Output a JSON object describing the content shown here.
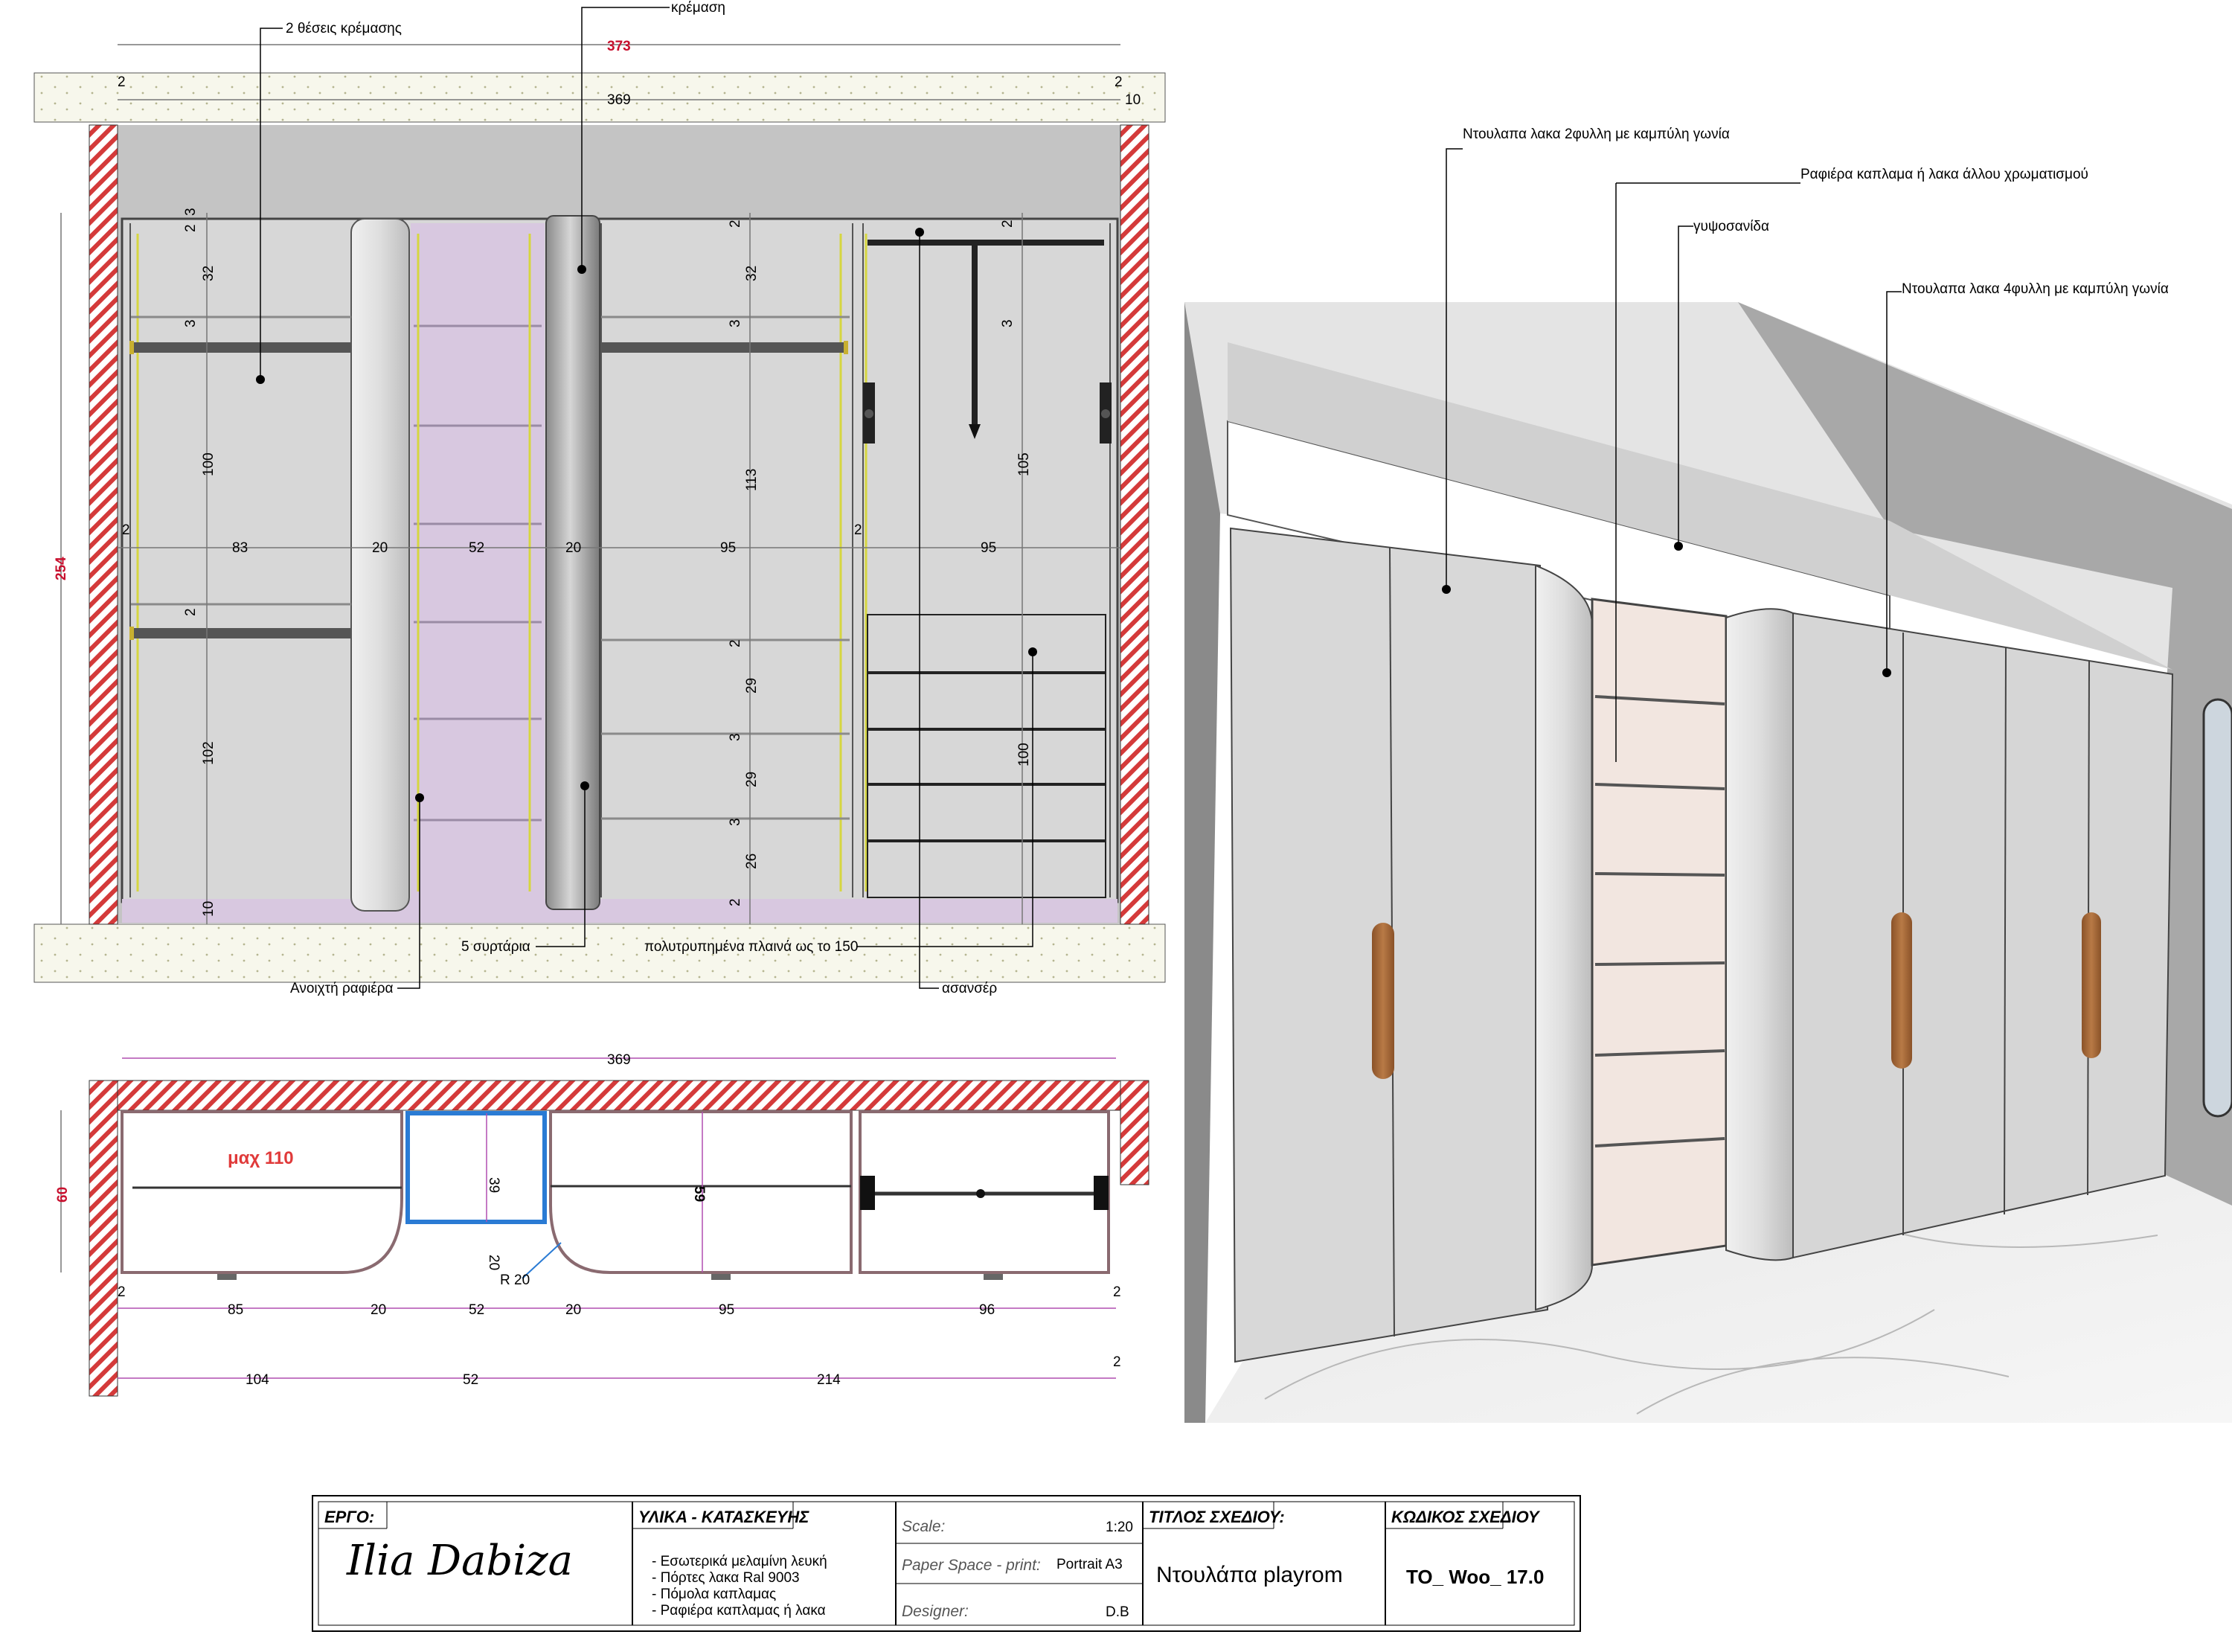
{
  "elevation": {
    "annotations": {
      "hanging_positions": "2 θέσεις κρέμασης",
      "hanging": "κρέμαση",
      "drawers": "5 συρτάρια",
      "open_shelf": "Ανοιχτή ραφιέρα",
      "perforated_sides": "πολυτρυπημένα πλαινά ως το 150",
      "lift": "ασανσέρ"
    },
    "dims": {
      "total_width": "373",
      "inner_width": "369",
      "height": "254",
      "left_edge": "2",
      "right_edge": "2",
      "right_ten": "10",
      "w83": "83",
      "w20a": "20",
      "w52": "52",
      "w20b": "20",
      "w95a": "95",
      "w95b": "95",
      "v2a": "2",
      "v3a": "3",
      "v32": "32",
      "v3b": "3",
      "v100": "100",
      "v2b": "2",
      "v102": "102",
      "v10": "10",
      "m2a": "2",
      "m32": "32",
      "m3": "3",
      "m113": "113",
      "m2b": "2",
      "m29a": "29",
      "m3b": "3",
      "m29b": "29",
      "m3c": "3",
      "m26": "26",
      "m2c": "2",
      "r2": "2",
      "r3": "3",
      "r105": "105",
      "r100": "100",
      "side2l": "2",
      "side2r": "2"
    }
  },
  "plan": {
    "dims": {
      "total": "369",
      "depth": "60",
      "max_label": "μαχ 110",
      "d39": "39",
      "d20": "20",
      "d59": "59",
      "radius": "R 20",
      "b85": "85",
      "b20a": "20",
      "b52": "52",
      "b20b": "20",
      "b95": "95",
      "b96": "96",
      "c104": "104",
      "c52": "52",
      "c214": "214",
      "edge2a": "2",
      "edge2b": "2",
      "edge2c": "2"
    }
  },
  "perspective": {
    "annotations": {
      "two_door": "Ντουλαπα λακα 2φυλλη με καμπύλη γωνία",
      "shelving": "Ραφιέρα καπλαμα ή λακα άλλου χρωματισμού",
      "plasterboard": "γυψοσανίδα",
      "four_door": "Ντουλαπα λακα 4φυλλη με καμπύλη γωνία"
    }
  },
  "title_block": {
    "project_label": "ΕΡΓΟ:",
    "project_name": "Ilia Dabiza",
    "materials_label": "ΥΛΙΚΑ - ΚΑΤΑΣΚΕΥΗΣ",
    "materials": [
      "- Εσωτερικά μελαμίνη λευκή",
      "- Πόρτες λακα Ral 9003",
      "- Πόμολα καπλαμας",
      "- Ραφιέρα καπλαμας ή λακα"
    ],
    "scale_label": "Scale:",
    "scale_value": "1:20",
    "paper_label": "Paper Space - print:",
    "paper_value": "Portrait A3",
    "designer_label": "Designer:",
    "designer_value": "D.B",
    "title_label": "ΤΙΤΛΟΣ ΣΧΕΔΙΟΥ:",
    "title_value": "Ντουλάπα playrom",
    "code_label": "ΚΩΔΙΚΟΣ ΣΧΕΔΙΟΥ",
    "code_value": "TO_ Woo_ 17.0"
  },
  "colors": {
    "dimension_line": "#b04fb0",
    "wall_hatch": "#d43a3a",
    "accent_red": "#c8102e",
    "lavender_panel": "#d8c8e0",
    "cabinet_grey": "#d4d4d4",
    "walnut": "#a86a3a"
  }
}
